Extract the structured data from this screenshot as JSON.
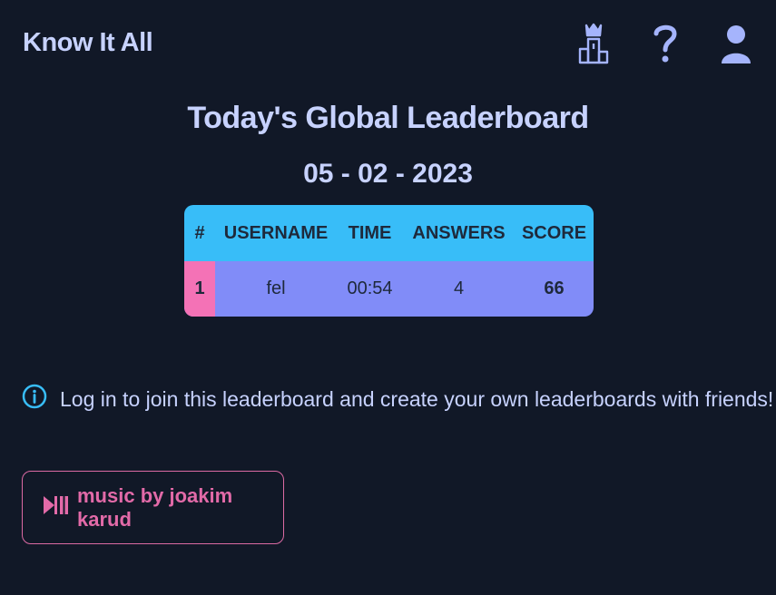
{
  "header": {
    "app_title": "Know It All",
    "icons": [
      "leaderboard-podium-icon",
      "help-question-icon",
      "user-account-icon"
    ]
  },
  "leaderboard": {
    "title": "Today's Global Leaderboard",
    "date": "05 - 02 - 2023",
    "columns": [
      "#",
      "USERNAME",
      "TIME",
      "ANSWERS",
      "SCORE"
    ],
    "rows": [
      {
        "rank": "1",
        "username": "fel",
        "time": "00:54",
        "answers": "4",
        "score": "66"
      }
    ]
  },
  "info": {
    "icon": "info-circle-icon",
    "message": "Log in to join this leaderboard and create your own leaderboards with friends!"
  },
  "music": {
    "icon": "play-pause-icon",
    "label": "music by joakim karud"
  },
  "colors": {
    "background": "#111827",
    "text": "#c7d2fe",
    "table_header": "#38bdf8",
    "table_row": "#818cf8",
    "rank_cell": "#f472b6",
    "music_accent": "#e26aa8",
    "info_icon": "#38bdf8"
  }
}
